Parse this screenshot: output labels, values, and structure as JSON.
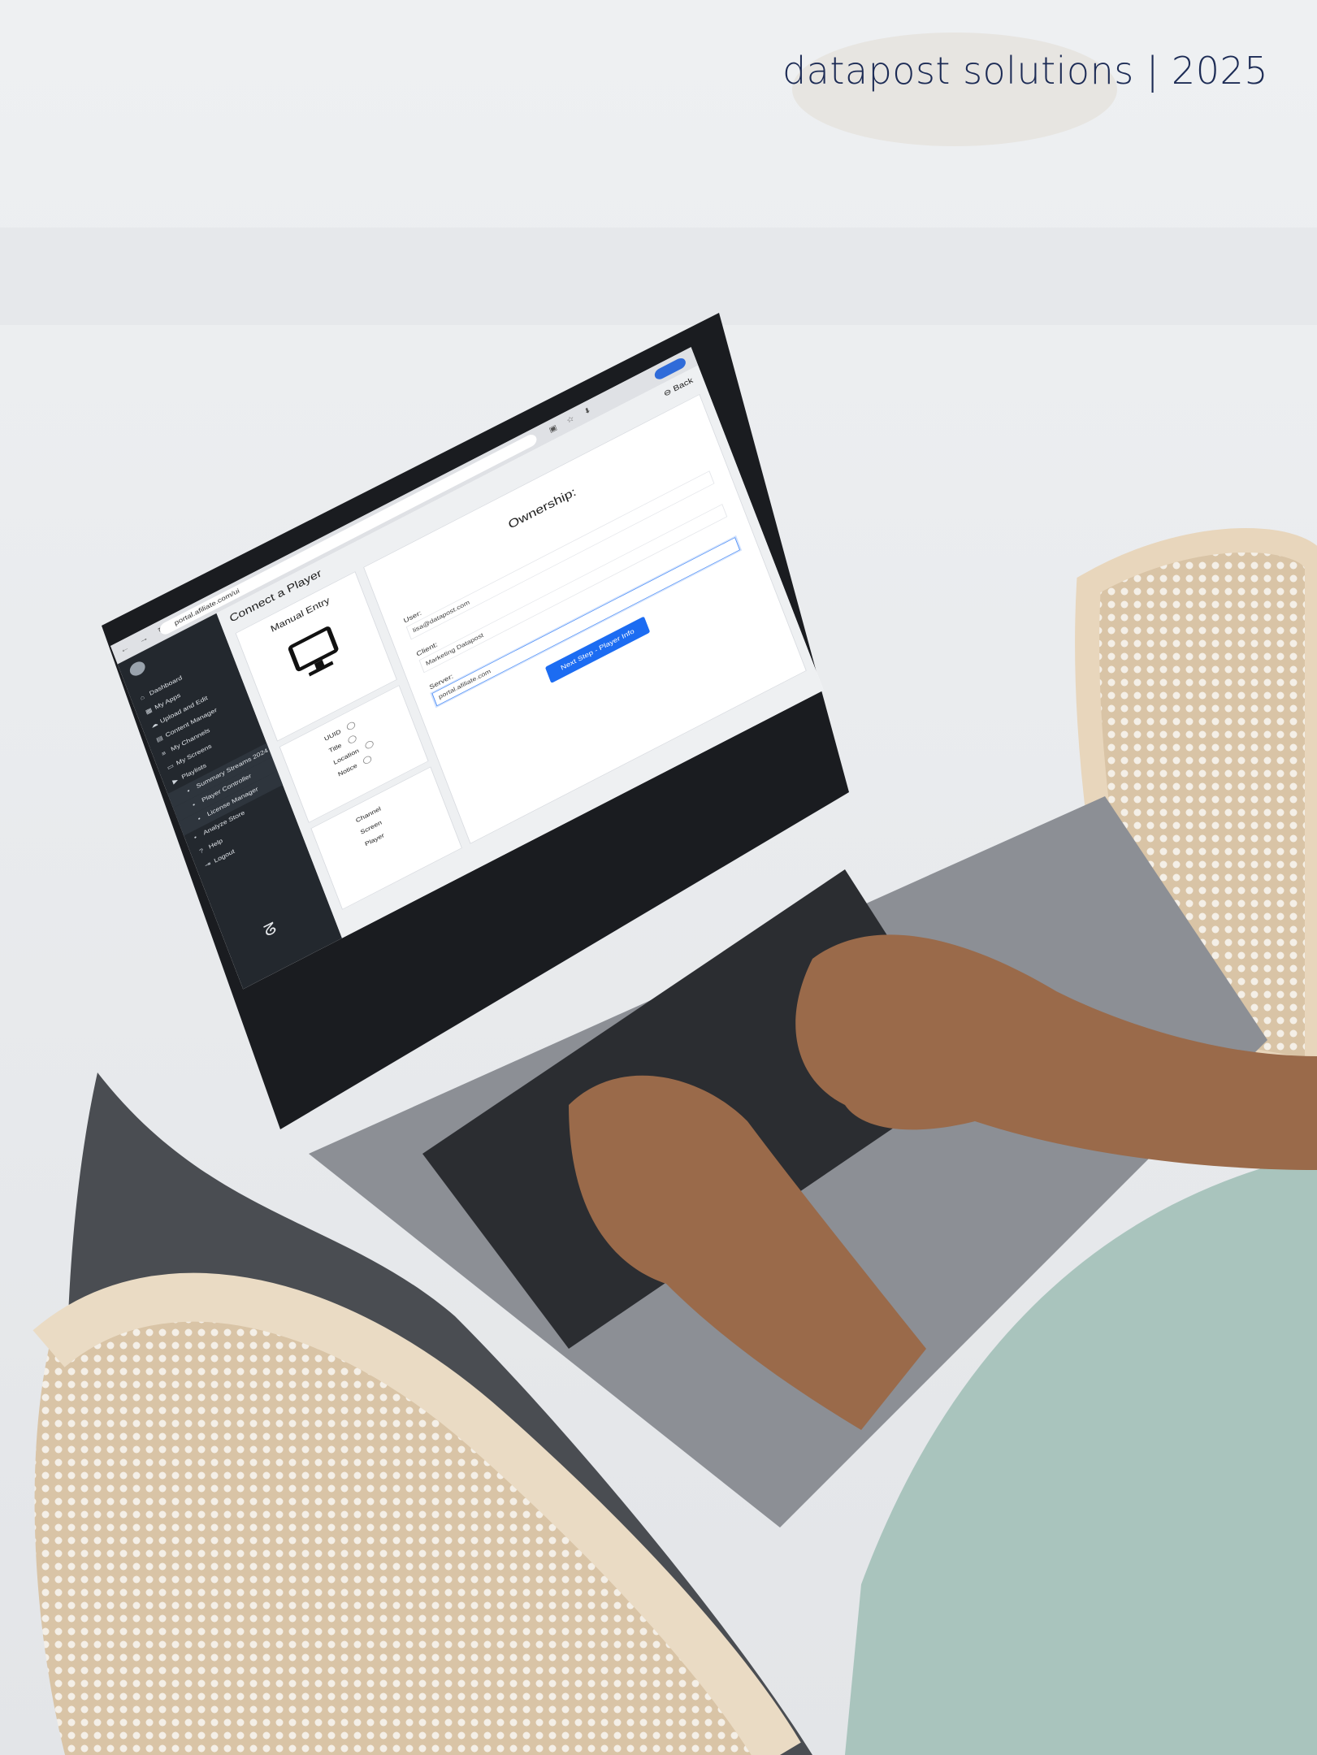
{
  "brand": {
    "text": "datapost solutions | 2025",
    "color": "#1c2b55"
  },
  "browser": {
    "url": "portal.afiliate.com/ui",
    "accent": "#2f6bd9"
  },
  "sidebar": {
    "items": [
      {
        "icon": "home-icon",
        "label": "Dashboard"
      },
      {
        "icon": "grid-icon",
        "label": "My Apps"
      },
      {
        "icon": "upload-icon",
        "label": "Upload and Edit"
      },
      {
        "icon": "folder-icon",
        "label": "Content Manager"
      },
      {
        "icon": "list-icon",
        "label": "My Channels"
      },
      {
        "icon": "monitor-icon",
        "label": "My Screens"
      },
      {
        "icon": "play-icon",
        "label": "Playlists"
      },
      {
        "icon": "dot-icon",
        "label": "Summary Streams 2024"
      },
      {
        "icon": "dot-icon",
        "label": "Player Controller"
      },
      {
        "icon": "dot-icon",
        "label": "License Manager"
      },
      {
        "icon": "dot-icon",
        "label": "Analyze Store"
      },
      {
        "icon": "help-icon",
        "label": "Help"
      },
      {
        "icon": "logout-icon",
        "label": "Logout"
      }
    ]
  },
  "page": {
    "title": "Connect a Player",
    "back": "Back"
  },
  "manual_entry": {
    "title": "Manual Entry",
    "icon": "monitor-icon"
  },
  "meta_fields": [
    "UUID",
    "Title",
    "Location",
    "Notice"
  ],
  "links": [
    "Channel",
    "Screen",
    "Player"
  ],
  "ownership": {
    "title": "Ownership:",
    "user_label": "User:",
    "user_value": "lisa@datapost.com",
    "client_label": "Client:",
    "client_value": "Marketing Datapost",
    "server_label": "Server:",
    "server_value": "portal.afiliate.com",
    "button": "Next Step - Player Info",
    "button_color": "#1c6cf2"
  }
}
